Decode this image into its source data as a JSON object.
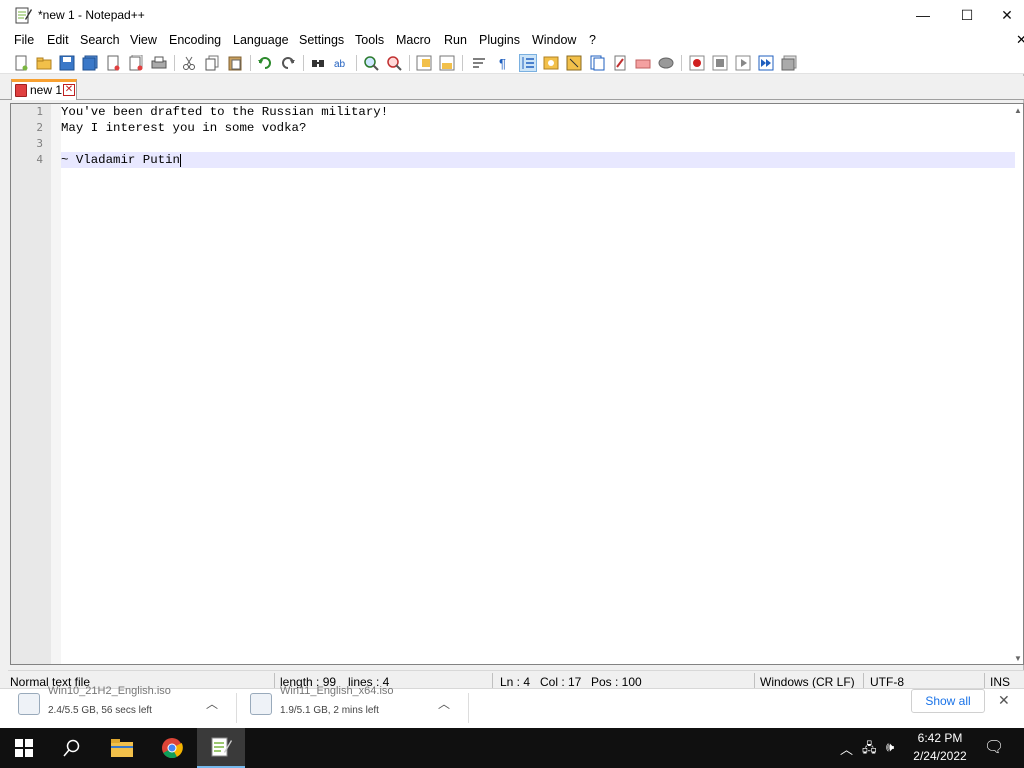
{
  "window": {
    "title": "*new 1 - Notepad++",
    "controls": {
      "minimize": "—",
      "maximize": "☐",
      "close": "✕"
    }
  },
  "menu": {
    "items": [
      "File",
      "Edit",
      "Search",
      "View",
      "Encoding",
      "Language",
      "Settings",
      "Tools",
      "Macro",
      "Run",
      "Plugins",
      "Window",
      "?"
    ],
    "close_glyph": "✕"
  },
  "toolbar": {
    "icons": [
      "new-file-icon",
      "open-file-icon",
      "save-icon",
      "save-all-icon",
      "close-icon",
      "close-all-icon",
      "print-icon",
      "cut-icon",
      "copy-icon",
      "paste-icon",
      "undo-icon",
      "redo-icon",
      "find-icon",
      "replace-icon",
      "zoom-in-icon",
      "zoom-out-icon",
      "sync-vertical-icon",
      "sync-horizontal-icon",
      "word-wrap-icon",
      "show-all-chars-icon",
      "indent-guide-icon",
      "udl-icon",
      "doc-map-icon",
      "function-list-icon",
      "folder-workspace-icon",
      "doc-switcher-icon",
      "monitoring-icon",
      "record-macro-icon",
      "stop-record-icon",
      "play-macro-icon",
      "run-macro-multiple-icon",
      "save-macro-icon"
    ]
  },
  "tabs": [
    {
      "label": "new 1",
      "close_glyph": "✕"
    }
  ],
  "editor": {
    "lines": [
      {
        "number": "1",
        "text": "You've been drafted to the Russian military!"
      },
      {
        "number": "2",
        "text": "May I interest you in some vodka?"
      },
      {
        "number": "3",
        "text": ""
      },
      {
        "number": "4",
        "text": "~ Vladamir Putin"
      }
    ],
    "current_line": 4
  },
  "statusbar": {
    "file_type": "Normal text file",
    "length": "length : 99",
    "lines": "lines : 4",
    "ln": "Ln : 4",
    "col": "Col : 17",
    "pos": "Pos : 100",
    "eol": "Windows (CR LF)",
    "encoding": "UTF-8",
    "mode": "INS"
  },
  "downloads": {
    "items": [
      {
        "name": "Win10_21H2_English.iso",
        "status": "2.4/5.5 GB, 56 secs left"
      },
      {
        "name": "Win11_English_x64.iso",
        "status": "1.9/5.1 GB, 2 mins left"
      }
    ],
    "show_all_label": "Show all",
    "close_glyph": "✕"
  },
  "taskbar": {
    "time": "6:42 PM",
    "date": "2/24/2022"
  },
  "colors": {
    "accent_tab": "#f8a030",
    "current_line": "#e8e8ff",
    "taskbar": "#101010"
  }
}
